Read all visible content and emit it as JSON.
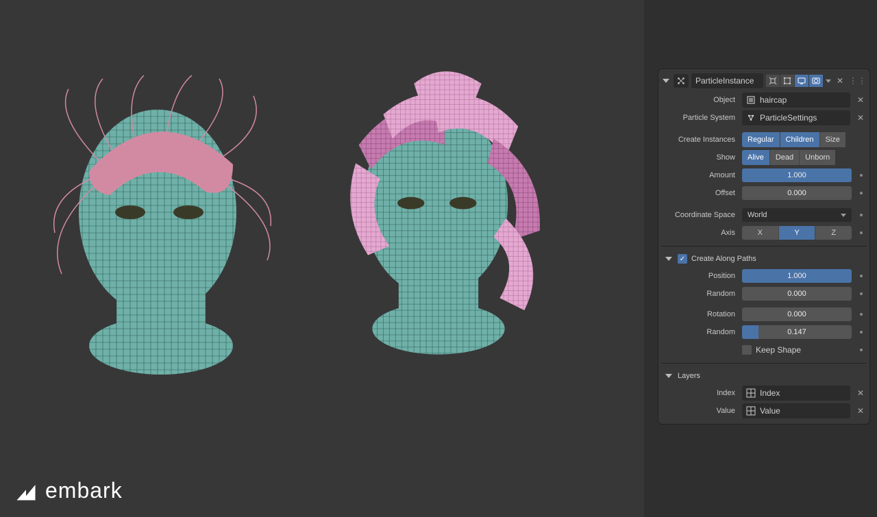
{
  "header": {
    "modifier_name": "ParticleInstance"
  },
  "fields": {
    "object_label": "Object",
    "object_value": "haircap",
    "particle_system_label": "Particle System",
    "particle_system_value": "ParticleSettings",
    "create_instances_label": "Create Instances",
    "instance_regular": "Regular",
    "instance_children": "Children",
    "instance_size": "Size",
    "show_label": "Show",
    "show_alive": "Alive",
    "show_dead": "Dead",
    "show_unborn": "Unborn",
    "amount_label": "Amount",
    "amount_value": "1.000",
    "offset_label": "Offset",
    "offset_value": "0.000",
    "coord_space_label": "Coordinate Space",
    "coord_space_value": "World",
    "axis_label": "Axis",
    "axis_x": "X",
    "axis_y": "Y",
    "axis_z": "Z",
    "create_along_paths": "Create Along Paths",
    "position_label": "Position",
    "position_value": "1.000",
    "random1_label": "Random",
    "random1_value": "0.000",
    "rotation_label": "Rotation",
    "rotation_value": "0.000",
    "random2_label": "Random",
    "random2_value": "0.147",
    "keep_shape": "Keep Shape",
    "layers": "Layers",
    "index_label": "Index",
    "index_value": "Index",
    "value_label": "Value",
    "value_value": "Value"
  },
  "logo_text": "embark"
}
